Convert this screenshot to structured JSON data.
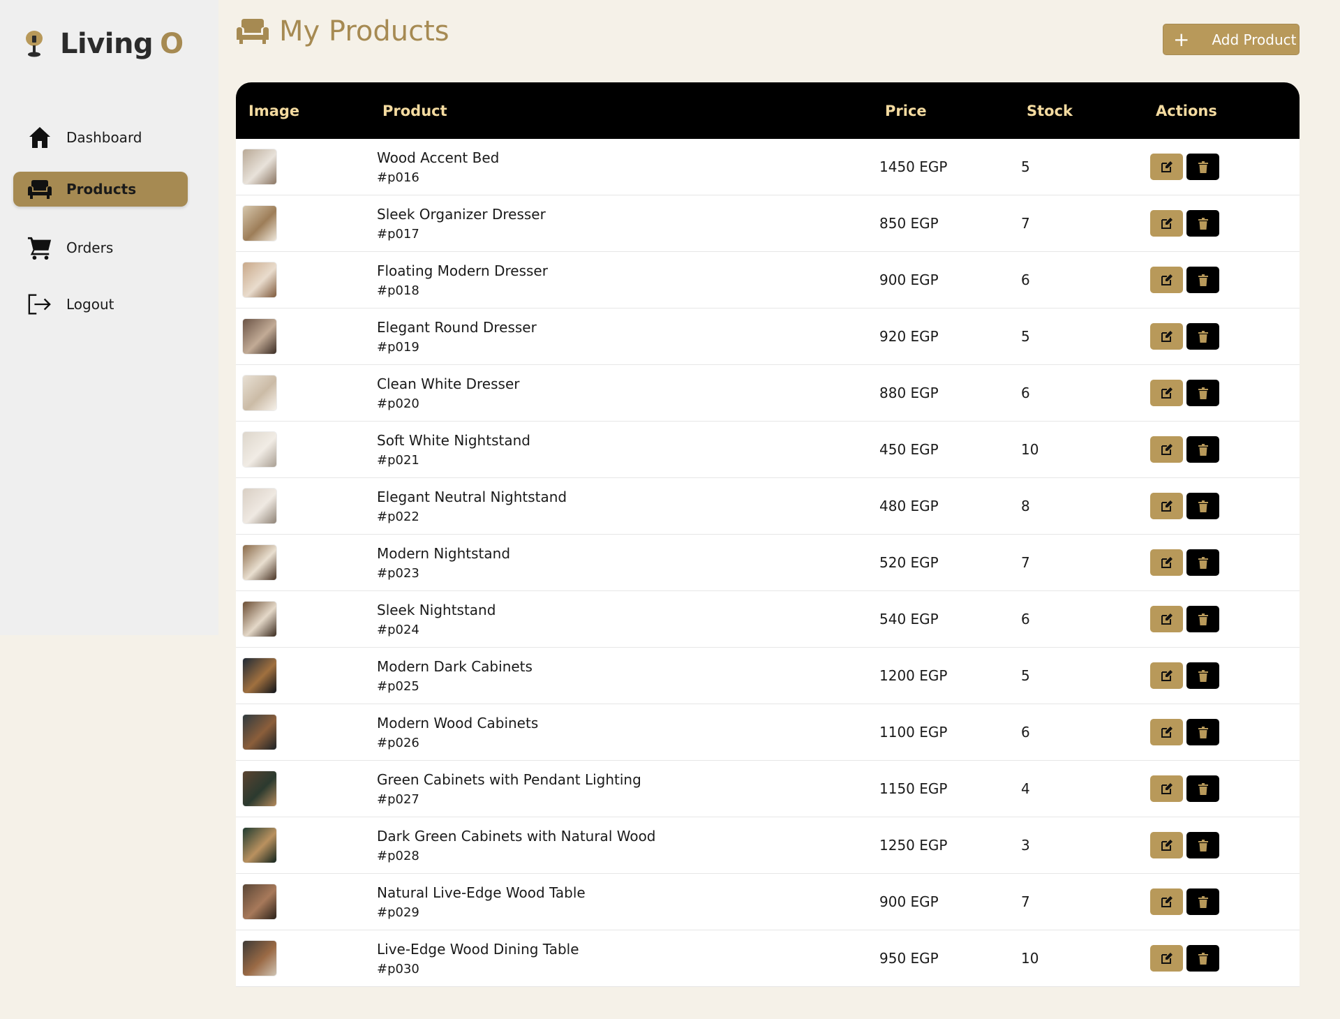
{
  "brand": {
    "name": "Living",
    "accent": "O",
    "color": "#a68a52"
  },
  "sidebar": {
    "items": [
      {
        "label": "Dashboard",
        "icon": "home-icon",
        "active": false
      },
      {
        "label": "Products",
        "icon": "couch-icon",
        "active": true
      },
      {
        "label": "Orders",
        "icon": "cart-icon",
        "active": false
      },
      {
        "label": "Logout",
        "icon": "logout-icon",
        "active": false
      }
    ]
  },
  "header": {
    "title": "My Products",
    "icon": "couch-icon",
    "add_label": "Add Product",
    "add_icon": "plus-icon"
  },
  "table": {
    "columns": [
      "Image",
      "Product",
      "Price",
      "Stock",
      "Actions"
    ],
    "rows": [
      {
        "name": "Wood Accent Bed",
        "id": "#p016",
        "price": "1450 EGP",
        "stock": "5",
        "thumb": [
          "#b9a996",
          "#e8e2da",
          "#8a7562"
        ]
      },
      {
        "name": "Sleek Organizer Dresser",
        "id": "#p017",
        "price": "850 EGP",
        "stock": "7",
        "thumb": [
          "#d6c7ad",
          "#9d7d58",
          "#efe8dc"
        ]
      },
      {
        "name": "Floating Modern Dresser",
        "id": "#p018",
        "price": "900 EGP",
        "stock": "6",
        "thumb": [
          "#c9a98a",
          "#e9dccd",
          "#7f5a3c"
        ]
      },
      {
        "name": "Elegant Round Dresser",
        "id": "#p019",
        "price": "920 EGP",
        "stock": "5",
        "thumb": [
          "#6b5446",
          "#c2ab96",
          "#3b2c24"
        ]
      },
      {
        "name": "Clean White Dresser",
        "id": "#p020",
        "price": "880 EGP",
        "stock": "6",
        "thumb": [
          "#e8e0d4",
          "#cbbba6",
          "#f6f1ea"
        ]
      },
      {
        "name": "Soft White Nightstand",
        "id": "#p021",
        "price": "450 EGP",
        "stock": "10",
        "thumb": [
          "#ddd6cb",
          "#f1ece5",
          "#a99f93"
        ]
      },
      {
        "name": "Elegant Neutral Nightstand",
        "id": "#p022",
        "price": "480 EGP",
        "stock": "8",
        "thumb": [
          "#d9cfc4",
          "#efe9e2",
          "#8f8376"
        ]
      },
      {
        "name": "Modern Nightstand",
        "id": "#p023",
        "price": "520 EGP",
        "stock": "7",
        "thumb": [
          "#8a6a49",
          "#e9dfd0",
          "#4a3526"
        ]
      },
      {
        "name": "Sleek Nightstand",
        "id": "#p024",
        "price": "540 EGP",
        "stock": "6",
        "thumb": [
          "#6b4d33",
          "#e4d8c8",
          "#3a2a1e"
        ]
      },
      {
        "name": "Modern Dark Cabinets",
        "id": "#p025",
        "price": "1200 EGP",
        "stock": "5",
        "thumb": [
          "#1f2a36",
          "#a0703f",
          "#0f141a"
        ]
      },
      {
        "name": "Modern Wood Cabinets",
        "id": "#p026",
        "price": "1100 EGP",
        "stock": "6",
        "thumb": [
          "#2f3a3f",
          "#8b5e3b",
          "#1c2226"
        ]
      },
      {
        "name": "Green Cabinets with Pendant Lighting",
        "id": "#p027",
        "price": "1150 EGP",
        "stock": "4",
        "thumb": [
          "#5a4331",
          "#2b3a2f",
          "#b48a5c"
        ]
      },
      {
        "name": "Dark Green Cabinets with Natural Wood",
        "id": "#p028",
        "price": "1250 EGP",
        "stock": "3",
        "thumb": [
          "#1f3b30",
          "#b9915f",
          "#12241d"
        ]
      },
      {
        "name": "Natural Live-Edge Wood Table",
        "id": "#p029",
        "price": "900 EGP",
        "stock": "7",
        "thumb": [
          "#5a4636",
          "#a7795a",
          "#2b2119"
        ]
      },
      {
        "name": "Live-Edge Wood Dining Table",
        "id": "#p030",
        "price": "950 EGP",
        "stock": "10",
        "thumb": [
          "#3e3a36",
          "#9a6a45",
          "#cfc3b3"
        ]
      }
    ],
    "actions": {
      "edit_icon": "edit-icon",
      "delete_icon": "trash-icon"
    }
  },
  "colors": {
    "accent": "#a68a52",
    "button": "#b8995a",
    "header_bg": "#000000",
    "header_text": "#f4dba0",
    "page_bg": "#f5f1e8",
    "sidebar_bg": "#efefef"
  }
}
